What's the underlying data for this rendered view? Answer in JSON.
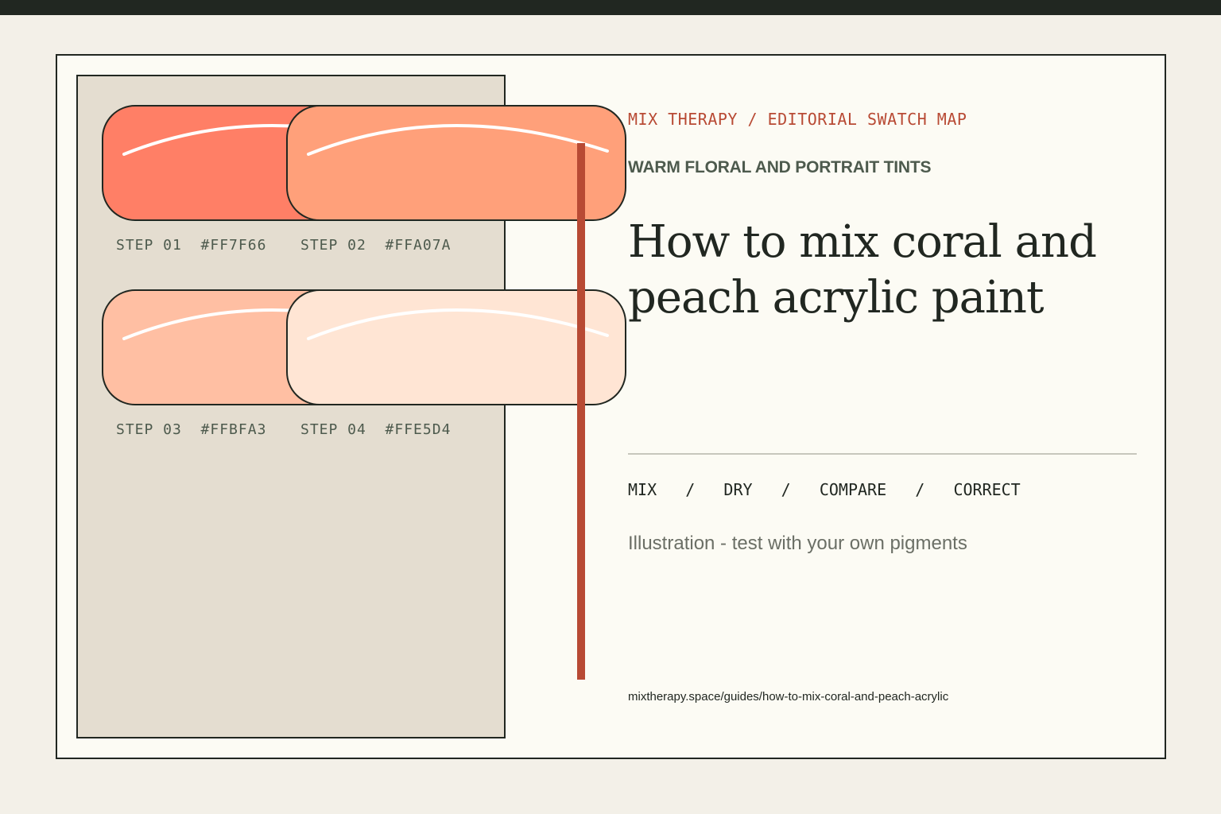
{
  "header": {
    "kicker": "MIX THERAPY / EDITORIAL SWATCH MAP",
    "subkicker": "WARM FLORAL AND PORTRAIT TINTS",
    "title_line1": "How to mix coral and",
    "title_line2": "peach acrylic paint"
  },
  "swatches": [
    {
      "step": "STEP 01",
      "hex": "#FF7F66",
      "color": "#FF7F66"
    },
    {
      "step": "STEP 02",
      "hex": "#FFA07A",
      "color": "#FFA07A"
    },
    {
      "step": "STEP 03",
      "hex": "#FFBFA3",
      "color": "#FFBFA3"
    },
    {
      "step": "STEP 04",
      "hex": "#FFE5D4",
      "color": "#FFE5D4"
    }
  ],
  "process": {
    "steps": [
      "MIX",
      "DRY",
      "COMPARE",
      "CORRECT"
    ],
    "separator": "/"
  },
  "note": "Illustration - test with your own pigments",
  "url": "mixtherapy.space/guides/how-to-mix-coral-and-peach-acrylic",
  "colors": {
    "ink": "#212721",
    "accent": "#b84a34",
    "panel": "#e4ddd0",
    "paper": "#fcfbf4"
  }
}
